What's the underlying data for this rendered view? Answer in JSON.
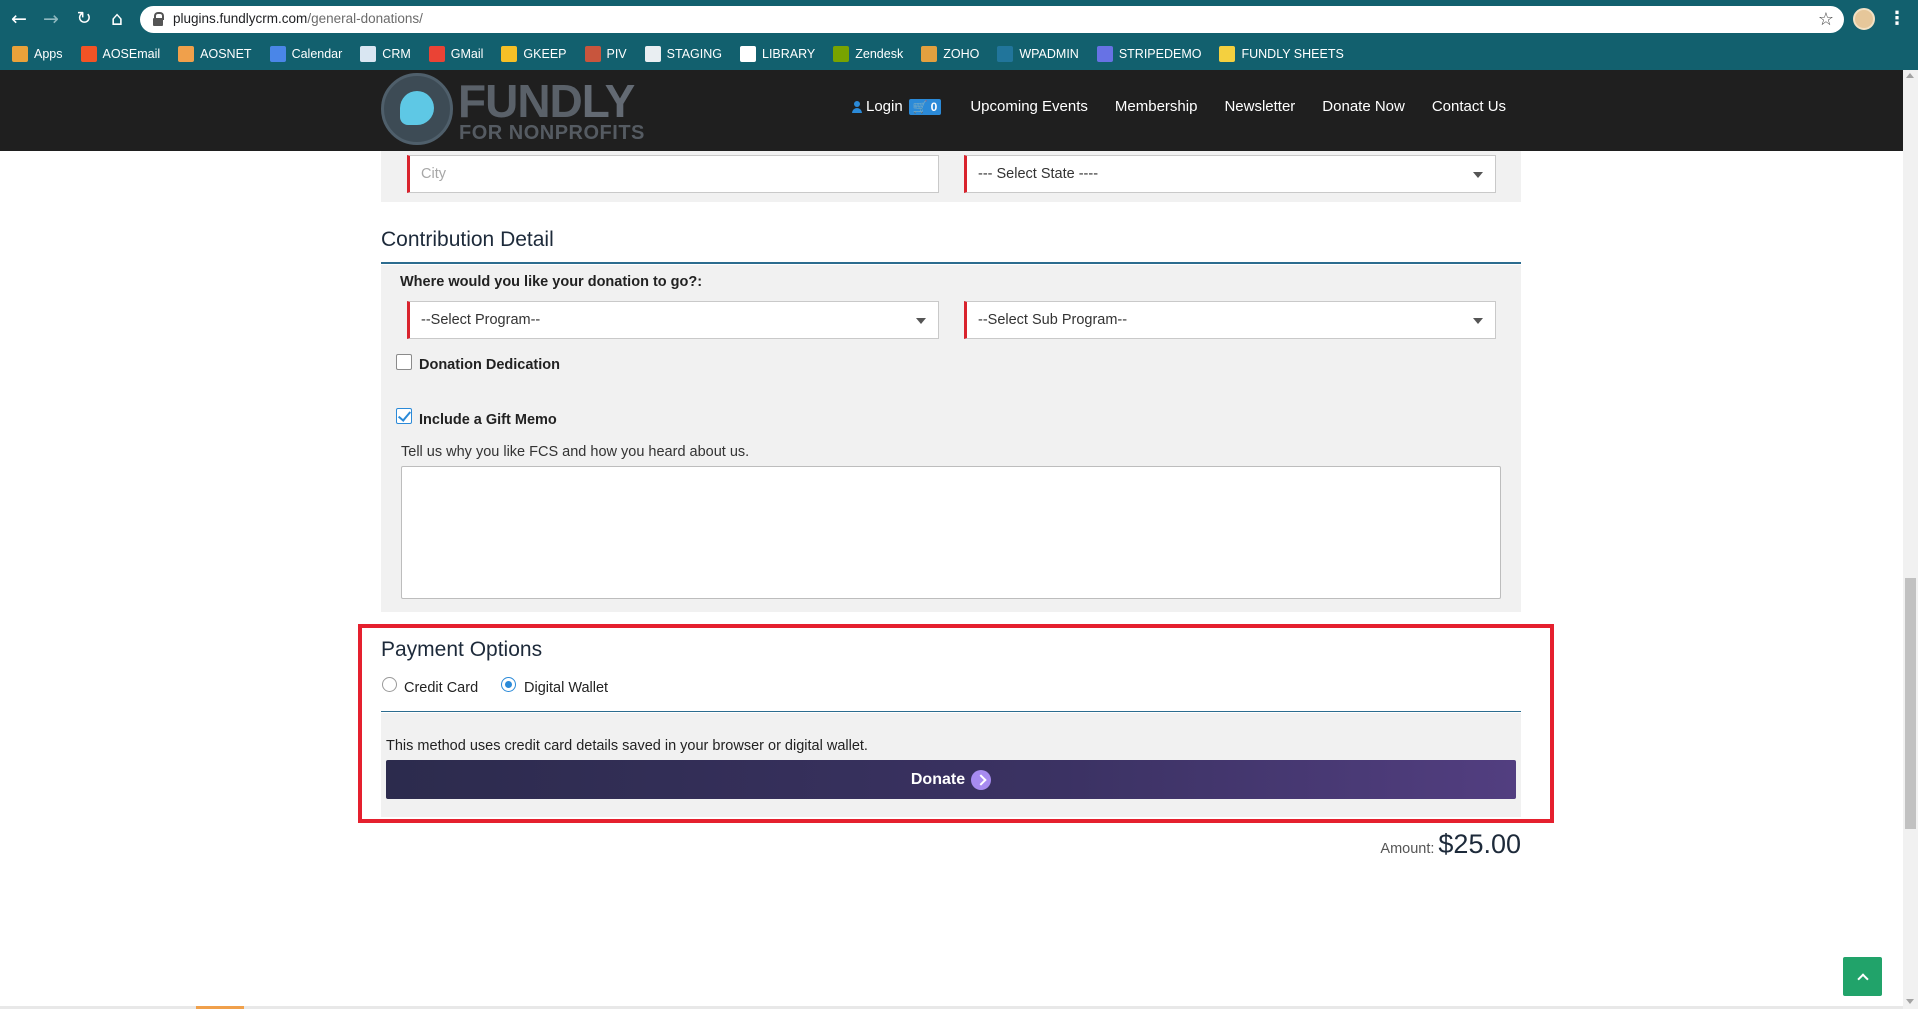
{
  "browser": {
    "url_host": "plugins.fundlycrm.com",
    "url_path": "/general-donations/",
    "bookmarks": [
      {
        "label": "Apps",
        "icon": "apps-grid-icon",
        "color": "#e8a23a"
      },
      {
        "label": "AOSEmail",
        "icon": "windows-logo-icon",
        "color": "#f35325"
      },
      {
        "label": "AOSNET",
        "icon": "folder-icon",
        "color": "#f0a04b"
      },
      {
        "label": "Calendar",
        "icon": "calendar-icon",
        "color": "#4a86e8"
      },
      {
        "label": "CRM",
        "icon": "document-icon",
        "color": "#d9e6f2"
      },
      {
        "label": "GMail",
        "icon": "gmail-icon",
        "color": "#ea4335"
      },
      {
        "label": "GKEEP",
        "icon": "keep-icon",
        "color": "#f6c026"
      },
      {
        "label": "PIV",
        "icon": "piv-icon",
        "color": "#c8553d"
      },
      {
        "label": "STAGING",
        "icon": "page-icon",
        "color": "#e9eef2"
      },
      {
        "label": "LIBRARY",
        "icon": "library-icon",
        "color": "#ffffff"
      },
      {
        "label": "Zendesk",
        "icon": "zendesk-icon",
        "color": "#78a300"
      },
      {
        "label": "ZOHO",
        "icon": "zoho-icon",
        "color": "#e2a03f"
      },
      {
        "label": "WPADMIN",
        "icon": "wordpress-icon",
        "color": "#21759b"
      },
      {
        "label": "STRIPEDEMO",
        "icon": "stripe-icon",
        "color": "#6772e5"
      },
      {
        "label": "FUNDLY SHEETS",
        "icon": "sheets-icon",
        "color": "#f4d03f"
      }
    ]
  },
  "header": {
    "logo_main": "FUND",
    "logo_accent": "LY",
    "logo_sub": "FOR NONPROFITS",
    "login": "Login",
    "cart_count": "0",
    "nav": [
      "Upcoming Events",
      "Membership",
      "Newsletter",
      "Donate Now",
      "Contact Us"
    ]
  },
  "address": {
    "city_placeholder": "City",
    "state_value": "--- Select State ----"
  },
  "contribution": {
    "title": "Contribution Detail",
    "question": "Where would you like your donation to go?:",
    "program_value": "--Select Program--",
    "sub_program_value": "--Select Sub Program--",
    "dedication_label": "Donation Dedication",
    "dedication_checked": false,
    "memo_label": "Include a Gift Memo",
    "memo_checked": true,
    "memo_prompt": "Tell us why you like FCS and how you heard about us."
  },
  "payment": {
    "title": "Payment Options",
    "options": [
      "Credit Card",
      "Digital Wallet"
    ],
    "selected": "Digital Wallet",
    "wallet_note": "This method uses credit card details saved in your browser or digital wallet.",
    "donate_label": "Donate"
  },
  "amount": {
    "label": "Amount:",
    "value": "$25.00"
  },
  "colors": {
    "chrome": "#12606e",
    "site_header": "#1f1f1f",
    "accent_blue": "#2b8ad8",
    "required_red": "#d9232d",
    "highlight_red": "#e5202e",
    "donate_button": "#3b3263",
    "back_to_top": "#21a36a"
  }
}
